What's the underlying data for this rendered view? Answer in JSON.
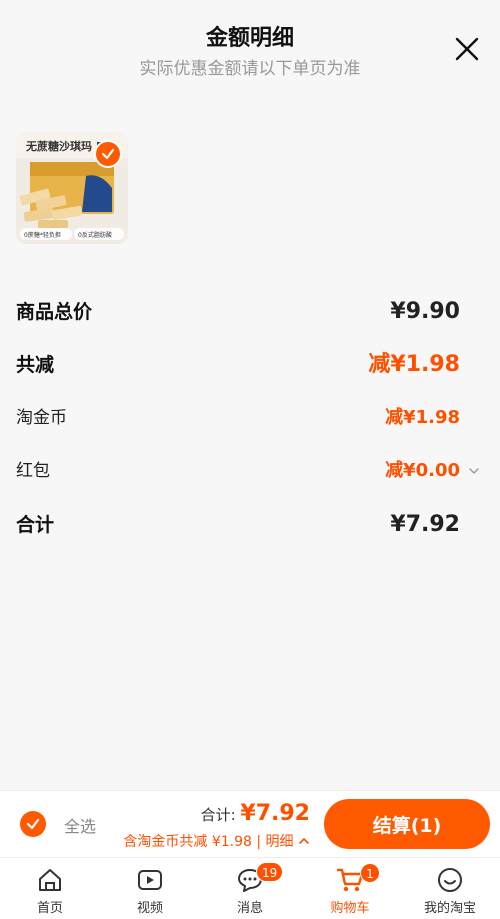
{
  "header": {
    "title": "金额明细",
    "subtitle": "实际优惠金额请以下单页为准"
  },
  "product": {
    "image_text": "无蔗糖沙琪玛 5",
    "tag1": "0蔗糖*轻负担",
    "tag2": "0反式脂肪酸",
    "selected": true
  },
  "breakdown": [
    {
      "label": "商品总价",
      "value": "¥9.90"
    },
    {
      "label": "共减",
      "value": "减¥1.98"
    },
    {
      "label": "淘金币",
      "value": "减¥1.98"
    },
    {
      "label": "红包",
      "value": "减¥0.00"
    },
    {
      "label": "合计",
      "value": "¥7.92"
    }
  ],
  "bottom_bar": {
    "select_all_label": "全选",
    "total_label": "合计:",
    "total_value": "¥7.92",
    "discount_text": "含淘金币共减 ¥1.98 | 明细",
    "checkout_label": "结算(1)"
  },
  "tabs": [
    {
      "label": "首页",
      "icon": "home-icon"
    },
    {
      "label": "视频",
      "icon": "video-icon"
    },
    {
      "label": "消息",
      "icon": "message-icon",
      "badge": "19"
    },
    {
      "label": "购物车",
      "icon": "cart-icon",
      "badge": "1",
      "active": true
    },
    {
      "label": "我的淘宝",
      "icon": "profile-icon"
    }
  ],
  "colors": {
    "accent": "#ff5000",
    "accent_button": "#ff5a00",
    "text_muted": "#999999"
  }
}
